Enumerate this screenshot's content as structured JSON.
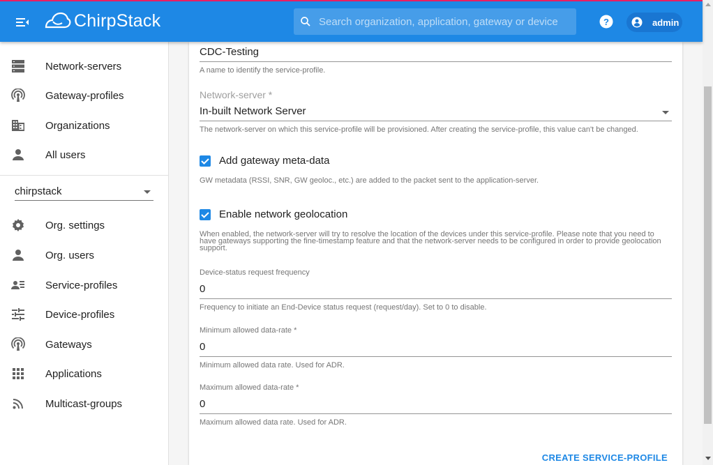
{
  "header": {
    "logo_text": "ChirpStack",
    "search_placeholder": "Search organization, application, gateway or device",
    "user_label": "admin",
    "accent_color": "#1e88e5"
  },
  "sidebar": {
    "global_items": [
      {
        "label": "Network-servers",
        "icon": "server-icon"
      },
      {
        "label": "Gateway-profiles",
        "icon": "antenna-icon"
      },
      {
        "label": "Organizations",
        "icon": "building-icon"
      },
      {
        "label": "All users",
        "icon": "user-icon"
      }
    ],
    "org_select": "chirpstack",
    "org_items": [
      {
        "label": "Org. settings",
        "icon": "gear-icon"
      },
      {
        "label": "Org. users",
        "icon": "user-icon"
      },
      {
        "label": "Service-profiles",
        "icon": "account-list-icon"
      },
      {
        "label": "Device-profiles",
        "icon": "tune-icon"
      },
      {
        "label": "Gateways",
        "icon": "antenna-icon"
      },
      {
        "label": "Applications",
        "icon": "apps-grid-icon"
      },
      {
        "label": "Multicast-groups",
        "icon": "rss-icon"
      }
    ]
  },
  "form": {
    "name": {
      "value": "CDC-Testing",
      "help": "A name to identify the service-profile."
    },
    "network_server": {
      "label": "Network-server *",
      "value": "In-built Network Server",
      "help": "The network-server on which this service-profile will be provisioned. After creating the service-profile, this value can't be changed."
    },
    "add_gw_metadata": {
      "label": "Add gateway meta-data",
      "checked": true,
      "help": "GW metadata (RSSI, SNR, GW geoloc., etc.) are added to the packet sent to the application-server."
    },
    "network_geolocation": {
      "label": "Enable network geolocation",
      "checked": true,
      "help": "When enabled, the network-server will try to resolve the location of the devices under this service-profile. Please note that you need to have gateways supporting the fine-timestamp feature and that the network-server needs to be configured in order to provide geolocation support."
    },
    "dev_status_freq": {
      "label": "Device-status request frequency",
      "value": "0",
      "help": "Frequency to initiate an End-Device status request (request/day). Set to 0 to disable."
    },
    "min_dr": {
      "label": "Minimum allowed data-rate *",
      "value": "0",
      "help": "Minimum allowed data rate. Used for ADR."
    },
    "max_dr": {
      "label": "Maximum allowed data-rate *",
      "value": "0",
      "help": "Maximum allowed data rate. Used for ADR."
    },
    "submit_label": "CREATE SERVICE-PROFILE"
  }
}
